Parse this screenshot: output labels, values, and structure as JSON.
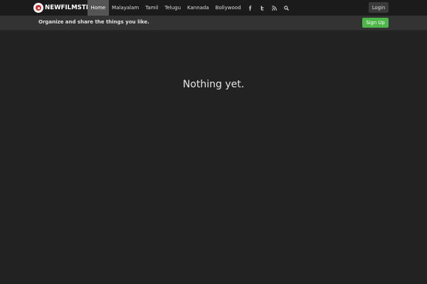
{
  "brand": {
    "name": "NEWFILMSTILLS",
    "logo_icon": "film-reel-icon",
    "accent": "#d9272e"
  },
  "nav": {
    "items": [
      {
        "label": "Home",
        "active": true
      },
      {
        "label": "Malayalam",
        "active": false
      },
      {
        "label": "Tamil",
        "active": false
      },
      {
        "label": "Telugu",
        "active": false
      },
      {
        "label": "Kannada",
        "active": false
      },
      {
        "label": "Bollywood",
        "active": false
      }
    ],
    "icons": [
      "facebook-icon",
      "twitter-icon",
      "rss-icon",
      "search-icon"
    ]
  },
  "header": {
    "login_label": "Login"
  },
  "subbar": {
    "tagline": "Organize and share the things you like.",
    "signup_label": "Sign Up",
    "signup_color": "#4cb748"
  },
  "main": {
    "empty_message": "Nothing yet."
  }
}
